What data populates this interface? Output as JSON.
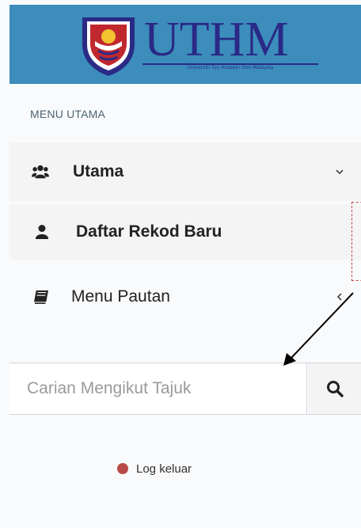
{
  "header": {
    "logo_text": "UTHM",
    "logo_subtitle": "Universiti Tun Hussein Onn Malaysia",
    "colors": {
      "header_bg": "#3c8dbc",
      "logo_ink": "#2a2a86"
    }
  },
  "sidebar": {
    "section_title": "MENU UTAMA",
    "items": [
      {
        "label": "Utama",
        "icon": "users-icon",
        "chevron": "chevron-down-icon"
      },
      {
        "label": "Daftar Rekod Baru",
        "icon": "user-icon"
      },
      {
        "label": "Menu Pautan",
        "icon": "book-icon",
        "chevron": "chevron-left-icon"
      }
    ]
  },
  "search": {
    "placeholder": "Carian Mengikut Tajuk",
    "value": "",
    "button_icon": "search-icon"
  },
  "logout": {
    "label": "Log keluar",
    "dot_color": "#b94a48"
  }
}
